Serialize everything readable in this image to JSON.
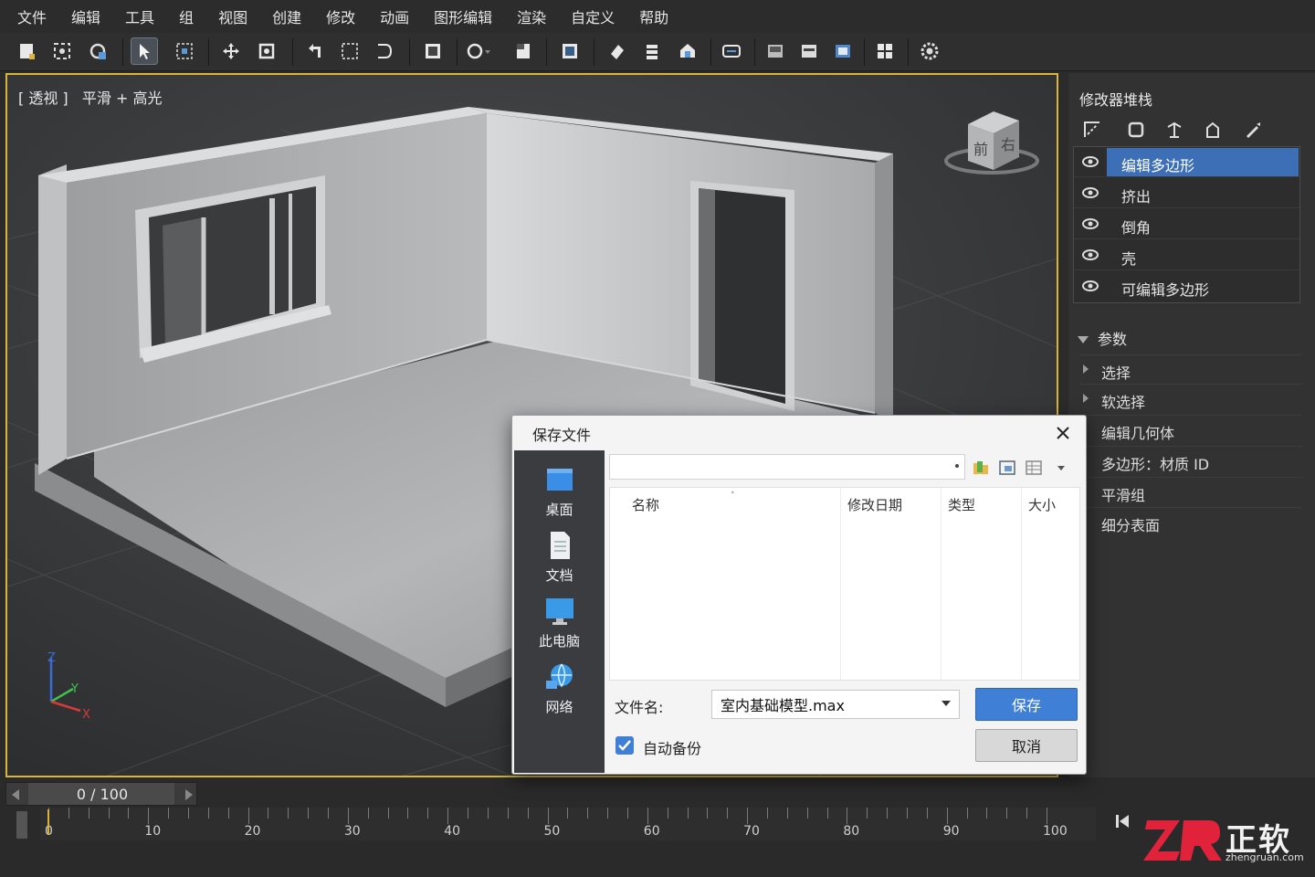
{
  "menu": [
    "文件",
    "编辑",
    "工具",
    "组",
    "视图",
    "创建",
    "修改",
    "动画",
    "图形编辑",
    "渲染",
    "自定义",
    "帮助"
  ],
  "viewport": {
    "label": "[ 透视 ]   平滑 + 高光",
    "viewcube": {
      "front": "前",
      "right": "右"
    },
    "axes": {
      "z": "Z",
      "y": "Y",
      "x": "X"
    }
  },
  "right_panel": {
    "title": "修改器堆栈",
    "modifiers": [
      {
        "label": "编辑多边形",
        "selected": true
      },
      {
        "label": "挤出",
        "selected": false
      },
      {
        "label": "倒角",
        "selected": false
      },
      {
        "label": "壳",
        "selected": false
      },
      {
        "label": "可编辑多边形",
        "selected": false
      }
    ],
    "params_title": "参数",
    "params": [
      "选择",
      "软选择",
      "编辑几何体",
      "多边形：材质 ID",
      "平滑组",
      "细分表面"
    ]
  },
  "timeline": {
    "frame_counter": "0 / 100",
    "labels": [
      "0",
      "10",
      "20",
      "30",
      "40",
      "50",
      "60",
      "70",
      "80",
      "90",
      "100"
    ]
  },
  "dialog": {
    "title": "保存文件",
    "places": [
      "桌面",
      "文档",
      "此电脑",
      "网络"
    ],
    "columns": [
      "名称",
      "修改日期",
      "类型",
      "大小"
    ],
    "filename_label": "文件名:",
    "filename_value": "室内基础模型.max",
    "save_label": "保存",
    "cancel_label": "取消",
    "autobackup_label": "自动备份",
    "autobackup_checked": true
  },
  "watermark": {
    "text": "正软",
    "url": "zhengruan.com"
  }
}
